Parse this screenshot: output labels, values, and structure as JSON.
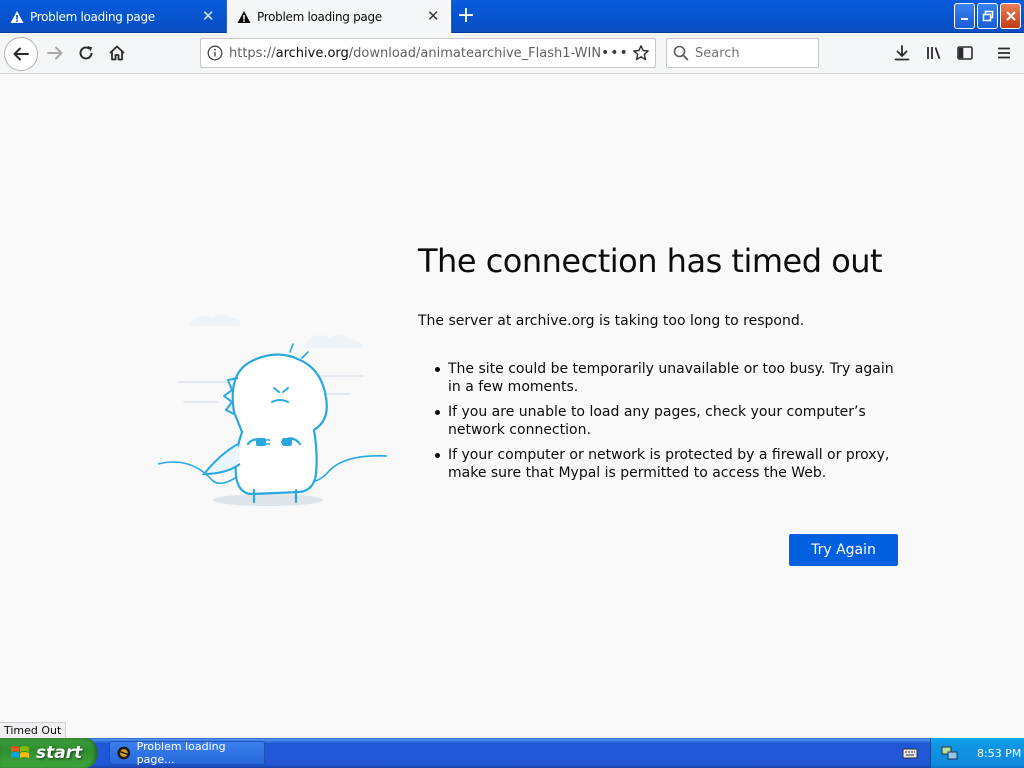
{
  "tabs": [
    {
      "title": "Problem loading page",
      "active": false
    },
    {
      "title": "Problem loading page",
      "active": true
    }
  ],
  "navbar": {
    "url_prefix": "https://",
    "url_host": "archive.org",
    "url_path": "/download/animatearchive_Flash1-WIN",
    "search_placeholder": "Search"
  },
  "error": {
    "title": "The connection has timed out",
    "description": "The server at archive.org is taking too long to respond.",
    "bullets": [
      "The site could be temporarily unavailable or too busy. Try again in a few moments.",
      "If you are unable to load any pages, check your computer’s network connection.",
      "If your computer or network is protected by a firewall or proxy, make sure that Mypal is permitted to access the Web."
    ],
    "button": "Try Again"
  },
  "status_text": "Timed Out",
  "taskbar": {
    "start_label": "start",
    "task_item": "Problem loading page...",
    "clock": "8:53 PM"
  },
  "colors": {
    "accent": "#0060df",
    "titlebar": "#0552cc",
    "illustration": "#29a8e0"
  }
}
